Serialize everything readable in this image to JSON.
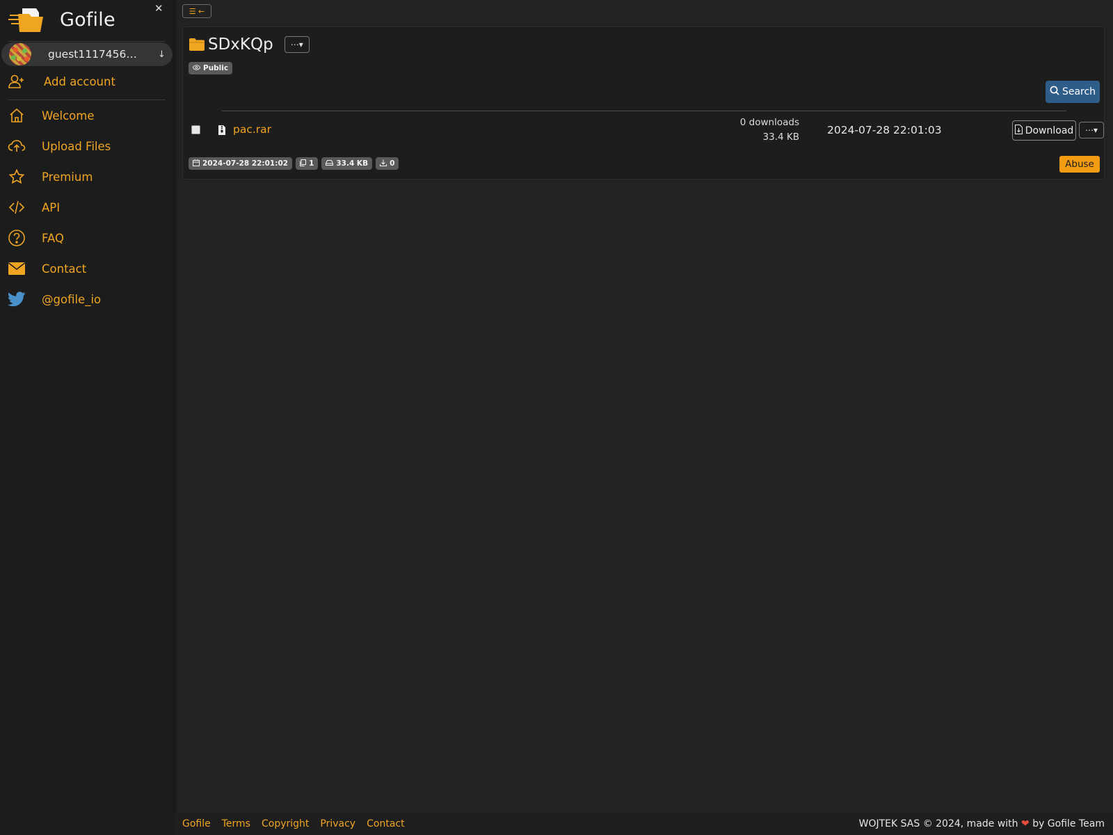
{
  "sidebar": {
    "brand": "Gofile",
    "close_glyph": "✕",
    "account": {
      "name": "guest11174566...",
      "chevron": "↓"
    },
    "add_account": "Add account",
    "items": [
      {
        "label": "Welcome",
        "icon": "house-icon"
      },
      {
        "label": "Upload Files",
        "icon": "cloud-upload-icon"
      },
      {
        "label": "Premium",
        "icon": "star-icon"
      },
      {
        "label": "API",
        "icon": "code-icon"
      },
      {
        "label": "FAQ",
        "icon": "question-circle-icon"
      },
      {
        "label": "Contact",
        "icon": "envelope-icon"
      },
      {
        "label": "@gofile_io",
        "icon": "twitter-icon"
      }
    ]
  },
  "toolbar": {
    "toggle_icon": "☰ ←"
  },
  "folder": {
    "name": "SDxKQp",
    "menu_label": "⋯▾",
    "visibility": "Public",
    "search_label": "Search"
  },
  "files": [
    {
      "name": "pac.rar",
      "downloads": "0 downloads",
      "size": "33.4 KB",
      "date": "2024-07-28 22:01:03",
      "download_label": "Download",
      "menu_label": "⋯▾"
    }
  ],
  "stats": {
    "created": "2024-07-28 22:01:02",
    "file_count": "1",
    "total_size": "33.4 KB",
    "total_downloads": "0"
  },
  "abuse_label": "Abuse",
  "footer": {
    "links": [
      "Gofile",
      "Terms",
      "Copyright",
      "Privacy",
      "Contact"
    ],
    "copyright_prefix": "WOJTEK SAS © 2024, made with",
    "heart": "❤",
    "copyright_suffix": "by Gofile Team"
  },
  "colors": {
    "accent": "#f0a522",
    "search_button": "#2f5d8a",
    "abuse_button": "#f39c12",
    "background": "#222222",
    "sidebar": "#1c1c1c"
  }
}
